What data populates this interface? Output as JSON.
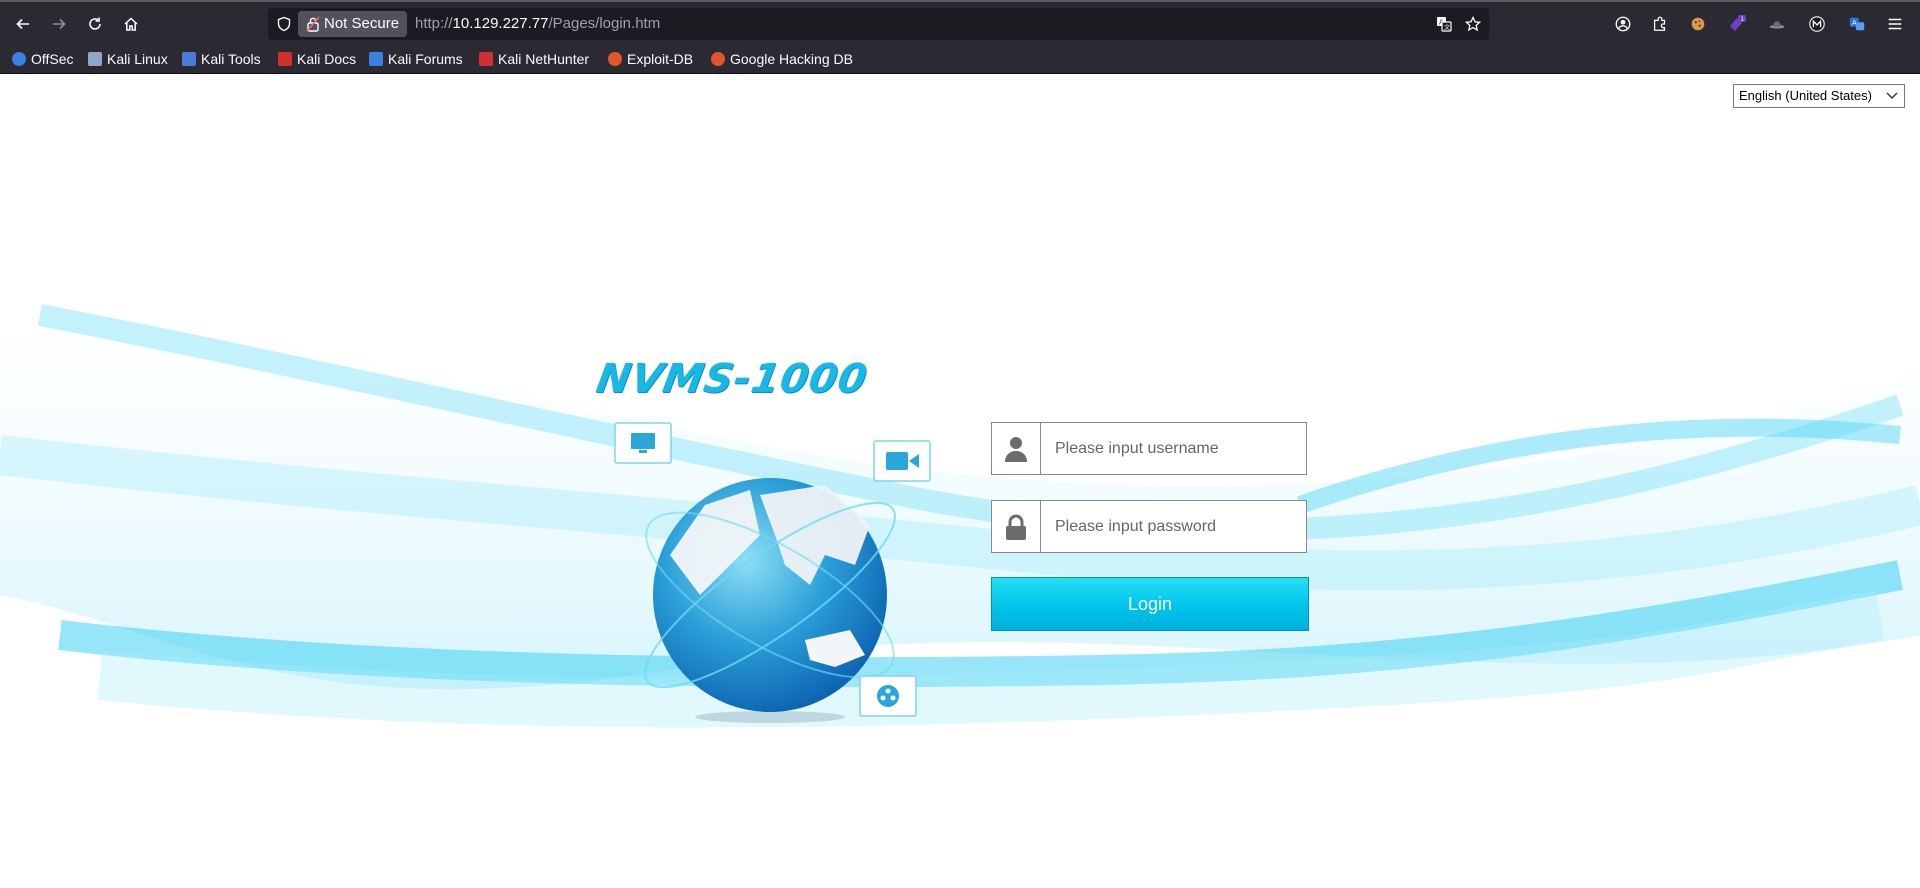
{
  "browser": {
    "not_secure_label": "Not Secure",
    "url_scheme": "http://",
    "url_host": "10.129.227.77",
    "url_path": "/Pages/login.htm",
    "bookmarks": [
      {
        "label": "OffSec",
        "color": "#3b7fe0"
      },
      {
        "label": "Kali Linux",
        "color": "#8fa6c8"
      },
      {
        "label": "Kali Tools",
        "color": "#4a7bd8"
      },
      {
        "label": "Kali Docs",
        "color": "#d32f2f"
      },
      {
        "label": "Kali Forums",
        "color": "#3b7fe0"
      },
      {
        "label": "Kali NetHunter",
        "color": "#d32f2f"
      },
      {
        "label": "Exploit-DB",
        "color": "#e2542c"
      },
      {
        "label": "Google Hacking DB",
        "color": "#e2542c"
      }
    ]
  },
  "page": {
    "language": "English (United States)",
    "logo_text": "NVMS-1000",
    "username_placeholder": "Please input username",
    "password_placeholder": "Please input password",
    "login_label": "Login",
    "accent_color": "#00c3ea"
  }
}
